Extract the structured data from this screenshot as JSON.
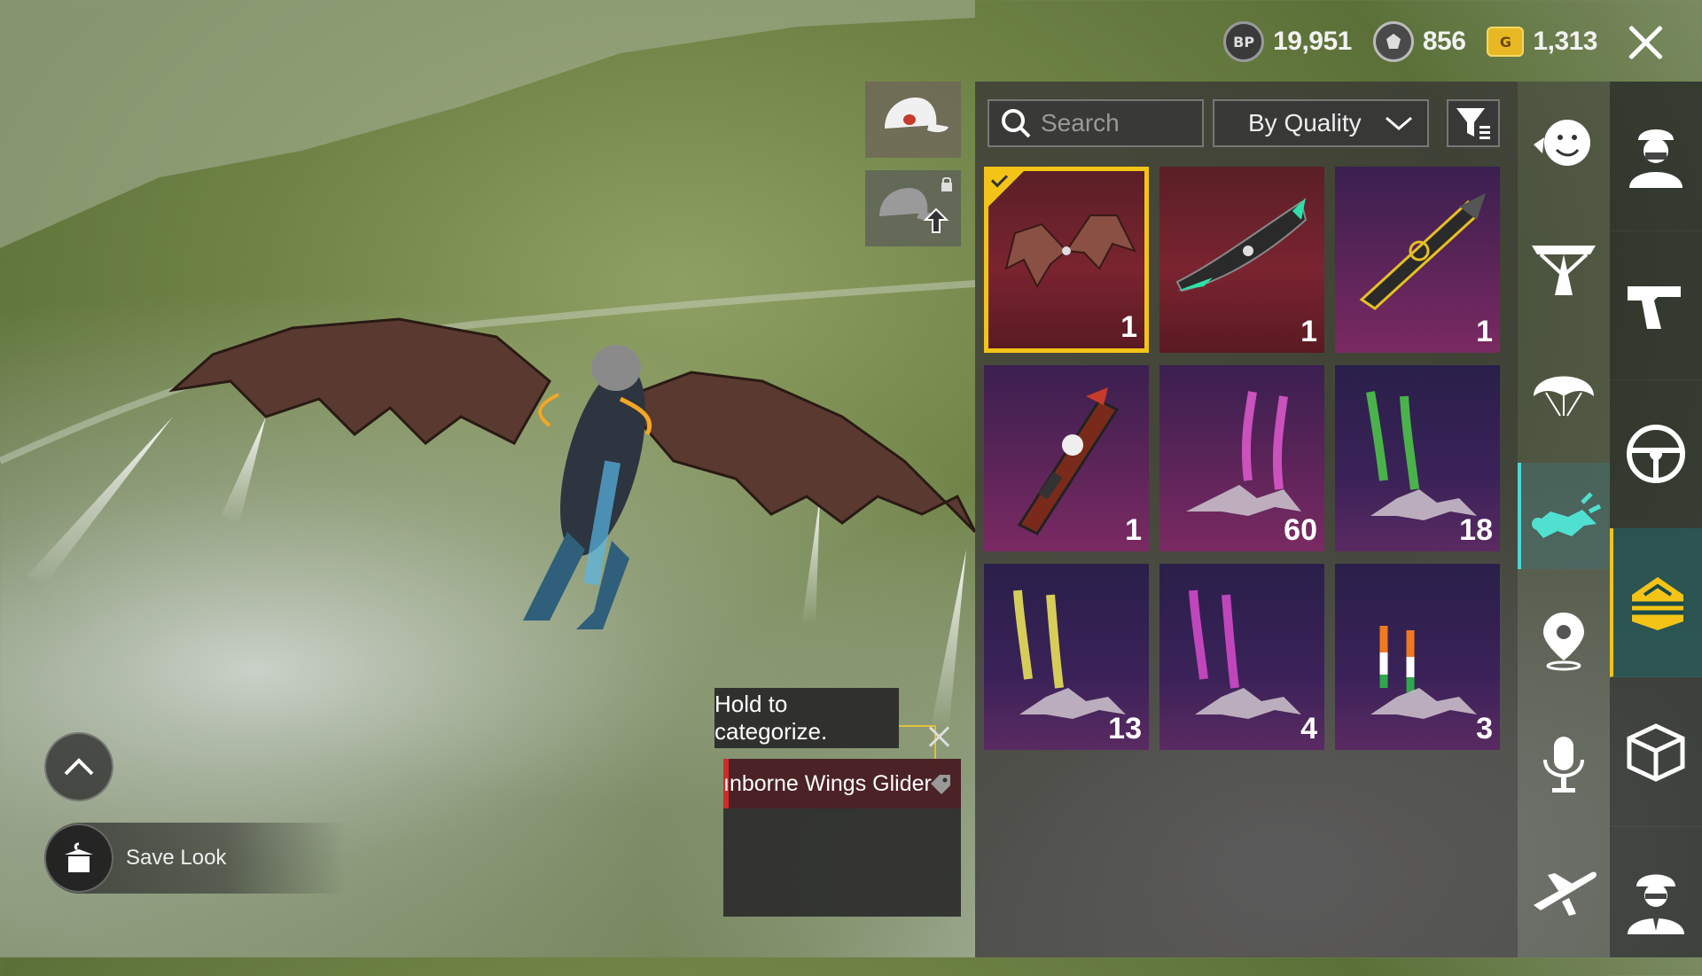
{
  "currency": {
    "bp_label": "BP",
    "bp_value": "19,951",
    "uc_value": "856",
    "g_label": "G",
    "g_value": "1,313"
  },
  "search": {
    "placeholder": "Search"
  },
  "sort": {
    "selected": "By Quality"
  },
  "items": [
    {
      "name": "bat-wings-glider",
      "count": "1",
      "quality": "red",
      "selected": true
    },
    {
      "name": "green-feather-glider",
      "count": "1",
      "quality": "red"
    },
    {
      "name": "golden-jet-glider",
      "count": "1",
      "quality": "purple"
    },
    {
      "name": "mech-glider",
      "count": "1",
      "quality": "purple"
    },
    {
      "name": "pink-trail",
      "count": "60",
      "quality": "purple"
    },
    {
      "name": "green-trail",
      "count": "18",
      "quality": "purple-dark"
    },
    {
      "name": "yellow-trail",
      "count": "13",
      "quality": "purple-dark"
    },
    {
      "name": "magenta-trail",
      "count": "4",
      "quality": "purple-dark"
    },
    {
      "name": "tricolor-trail",
      "count": "3",
      "quality": "purple-dark"
    }
  ],
  "tooltip": {
    "text": "Hold to categorize."
  },
  "selected_item": {
    "name": "ınborne Wings Glider"
  },
  "bottom": {
    "save_look": "Save Look"
  },
  "colors": {
    "selected_border": "#f3c417",
    "accent_teal": "#4fd6d6"
  }
}
